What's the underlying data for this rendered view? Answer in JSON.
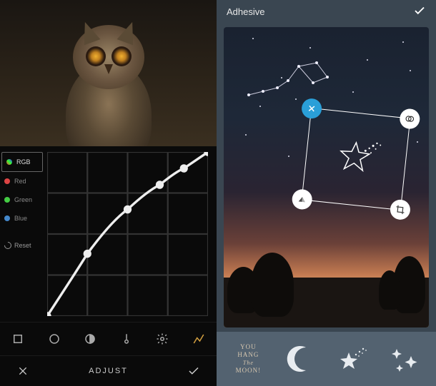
{
  "left": {
    "channels": {
      "rgb": "RGB",
      "red": "Red",
      "green": "Green",
      "blue": "Blue"
    },
    "reset_label": "Reset",
    "tools": {
      "crop": "crop",
      "circle": "vignette",
      "adjust": "adjust",
      "temperature": "temperature",
      "settings": "settings",
      "curves": "curves"
    },
    "bottom": {
      "cancel": "✕",
      "title": "ADJUST",
      "confirm": "✓"
    },
    "curve_points": [
      {
        "x": 0.0,
        "y": 1.0
      },
      {
        "x": 0.25,
        "y": 0.62
      },
      {
        "x": 0.5,
        "y": 0.35
      },
      {
        "x": 0.7,
        "y": 0.2
      },
      {
        "x": 0.85,
        "y": 0.1
      },
      {
        "x": 1.0,
        "y": 0.0
      }
    ]
  },
  "right": {
    "header_title": "Adhesive",
    "handles": {
      "close": "close",
      "overlap": "blend-mode",
      "flip": "flip",
      "crop": "crop-sticker"
    },
    "tray": {
      "text_sticker": "YOU\nHANG\nThe\nMOON!",
      "moon": "crescent-moon",
      "shooting": "shooting-star",
      "sparkles": "sparkles"
    }
  }
}
